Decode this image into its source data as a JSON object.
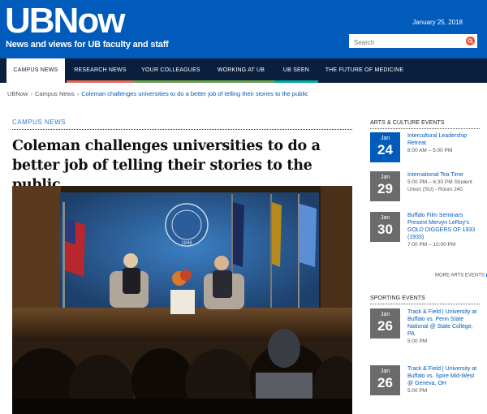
{
  "header": {
    "logo": "UBNow",
    "tagline": "News and views for UB faculty and staff",
    "date": "January 25, 2018",
    "search_placeholder": "Search"
  },
  "nav": {
    "items": [
      {
        "label": "CAMPUS NEWS",
        "stripe": "#ffffff"
      },
      {
        "label": "RESEARCH NEWS",
        "stripe": "#e56a54"
      },
      {
        "label": "YOUR COLLEAGUES",
        "stripe": "#6da04b"
      },
      {
        "label": "WORKING AT UB",
        "stripe": "#6da04b"
      },
      {
        "label": "UB SEEN",
        "stripe": "#00a69c"
      },
      {
        "label": "THE FUTURE OF MEDICINE",
        "stripe": "#0a1f3d"
      }
    ]
  },
  "breadcrumb": {
    "home": "UBNow",
    "section": "Campus News",
    "current": "Coleman challenges universities to do a better job of telling their stories to the public"
  },
  "article": {
    "section": "CAMPUS NEWS",
    "headline": "Coleman challenges universities to do a better job of telling their stories to the public"
  },
  "sidebar": {
    "arts_title": "ARTS & CULTURE EVENTS",
    "arts_events": [
      {
        "month": "Jan",
        "day": "24",
        "title": "Intercultural Leadership Retreat",
        "time": "8:00 AM – 5:00 PM",
        "highlight": true
      },
      {
        "month": "Jan",
        "day": "29",
        "title": "International Tea Time",
        "time": "5:00 PM – 6:30 PM Student Union (SU) - Room 240",
        "highlight": false
      },
      {
        "month": "Jan",
        "day": "30",
        "title": "Buffalo Film Seminars Present Mervyn LeRoy's GOLD DIGGERS OF 1933 (1933)",
        "time": "7:00 PM – 10:00 PM",
        "highlight": false
      }
    ],
    "more_label": "MORE ARTS EVENTS",
    "sport_title": "SPORTING EVENTS",
    "sport_events": [
      {
        "month": "Jan",
        "day": "26",
        "title": "Track & Field | University at Buffalo vs. Penn State National @ State College, PA",
        "time": "5:00 PM"
      },
      {
        "month": "Jan",
        "day": "26",
        "title": "Track & Field | University at Buffalo vs. Spire Mid-West @ Geneva, OH",
        "time": "5:00 PM"
      }
    ]
  }
}
